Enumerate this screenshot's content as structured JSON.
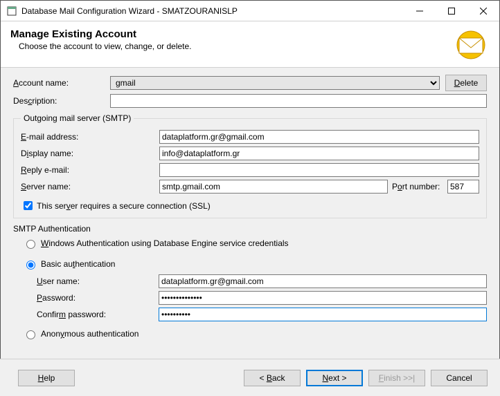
{
  "window": {
    "title": "Database Mail Configuration Wizard - SMATZOURANISLP"
  },
  "header": {
    "title": "Manage Existing Account",
    "subtitle": "Choose the account to view, change, or delete."
  },
  "account": {
    "name_label": "Account name:",
    "name_label_u": "A",
    "name_value": "gmail",
    "delete_label": "Delete",
    "delete_label_u": "D",
    "desc_label": "Description:",
    "desc_label_u": "c",
    "desc_value": ""
  },
  "smtp": {
    "legend": "Outgoing mail server (SMTP)",
    "email_label": "E-mail address:",
    "email_label_u": "E",
    "email_value": "dataplatform.gr@gmail.com",
    "display_label": "Display name:",
    "display_label_u": "i",
    "display_value": "info@dataplatform.gr",
    "reply_label": "Reply e-mail:",
    "reply_label_u": "R",
    "reply_value": "",
    "server_label": "Server name:",
    "server_label_u": "S",
    "server_value": "smtp.gmail.com",
    "port_label": "Port number:",
    "port_label_u": "o",
    "port_value": "587",
    "ssl_label": "This server requires a secure connection (SSL)",
    "ssl_label_u": "v",
    "ssl_checked": true
  },
  "auth": {
    "section": "SMTP Authentication",
    "windows_label": "Windows Authentication using Database Engine service credentials",
    "windows_label_u": "W",
    "basic_label": "Basic authentication",
    "basic_label_u": "t",
    "anon_label": "Anonymous authentication",
    "anon_label_u": "y",
    "selected": "basic",
    "user_label": "User name:",
    "user_label_u": "U",
    "user_value": "dataplatform.gr@gmail.com",
    "pass_label": "Password:",
    "pass_label_u": "P",
    "pass_value": "••••••••••••••",
    "confirm_label": "Confirm password:",
    "confirm_label_u": "m",
    "confirm_value": "••••••••••"
  },
  "footer": {
    "help": "Help",
    "help_u": "H",
    "back": "< Back",
    "back_u": "B",
    "next": "Next >",
    "next_u": "N",
    "finish": "Finish >>|",
    "finish_u": "F",
    "cancel": "Cancel"
  }
}
